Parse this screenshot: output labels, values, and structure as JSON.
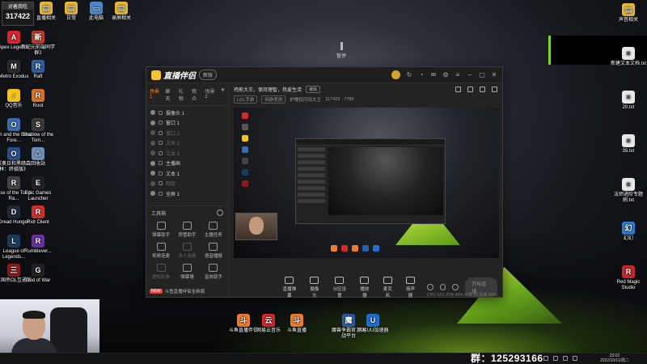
{
  "counter": {
    "title": "对着我吃",
    "value": "317422"
  },
  "desktop_left": [
    {
      "label": "Apex Legends",
      "color": "#d7262e",
      "glyph": "A"
    },
    {
      "label": "Metro Exodus",
      "color": "#2b2b2b",
      "glyph": "M"
    },
    {
      "label": "QQ音乐",
      "color": "#f3c316",
      "glyph": "♪"
    },
    {
      "label": "Ori and the Blind Fore...",
      "color": "#3a6db0",
      "glyph": "O"
    },
    {
      "label": "《奥日和黑暗森林：终极版》",
      "color": "#2b4f8a",
      "glyph": "O"
    },
    {
      "label": "Rise of the Tomb Ra...",
      "color": "#444",
      "glyph": "R"
    },
    {
      "label": "Dread Hunger",
      "color": "#1c2a3c",
      "glyph": "D"
    },
    {
      "label": "League of Legends...",
      "color": "#1c3a5c",
      "glyph": "L"
    },
    {
      "label": "三国杀OL互通版",
      "color": "#8b1a1a",
      "glyph": "三"
    }
  ],
  "desktop_left2": [
    {
      "label": "新纪元前端同学群2",
      "color": "#c23a2a",
      "glyph": "新"
    },
    {
      "label": "Raft",
      "color": "#2d5f9b",
      "glyph": "R"
    },
    {
      "label": "Root",
      "color": "#d8742a",
      "glyph": "R"
    },
    {
      "label": "Shadow of the Tom...",
      "color": "#3a3a3a",
      "glyph": "S"
    },
    {
      "label": "回收站",
      "color": "#6b8fb8",
      "glyph": "♺"
    },
    {
      "label": "Epic Games Launcher",
      "color": "#222",
      "glyph": "E"
    },
    {
      "label": "Riot Client",
      "color": "#d0302b",
      "glyph": "R"
    },
    {
      "label": "Rumblever...",
      "color": "#6b2fa3",
      "glyph": "R"
    },
    {
      "label": "God of War",
      "color": "#222",
      "glyph": "G"
    }
  ],
  "desktop_top": [
    {
      "label": "直播相关",
      "color": "#e4b63a",
      "glyph": "▤"
    },
    {
      "label": "日常",
      "color": "#e4b63a",
      "glyph": "▤"
    },
    {
      "label": "此电脑",
      "color": "#4a87c9",
      "glyph": "▭"
    },
    {
      "label": "录屏相关",
      "color": "#e4b63a",
      "glyph": "▤"
    }
  ],
  "desktop_right": [
    {
      "label": "声音相关",
      "color": "#e4b63a",
      "glyph": "▤"
    },
    {
      "label": "新建文本文档.txt",
      "color": "#e8e8e8",
      "glyph": "≡"
    },
    {
      "label": "20.txt",
      "color": "#e8e8e8",
      "glyph": "≡"
    },
    {
      "label": "35.txt",
      "color": "#e8e8e8",
      "glyph": "≡"
    },
    {
      "label": "法师进阶专题刷.txt",
      "color": "#e8e8e8",
      "glyph": "≡"
    },
    {
      "label": "幻幻",
      "color": "#2a7fd4",
      "glyph": "幻"
    },
    {
      "label": "Red Magic Studio",
      "color": "#c2262e",
      "glyph": "R"
    }
  ],
  "desktop_bottom": [
    {
      "label": "斗鱼直播伴侣",
      "color": "#f07b2b",
      "glyph": "斗"
    },
    {
      "label": "网易云音乐",
      "color": "#d8262e",
      "glyph": "云"
    },
    {
      "label": "斗鱼直播",
      "color": "#f07b2b",
      "glyph": "斗"
    },
    {
      "label": "魔兽争霸官方对战平台",
      "color": "#2b5fa8",
      "glyph": "魔"
    },
    {
      "label": "网易UU加速器",
      "color": "#1d6fd0",
      "glyph": "U"
    }
  ],
  "center_tag": "暂停",
  "window": {
    "app_name": "直播伴侣",
    "badge": "新版",
    "left_tabs": [
      "场景1",
      "聊天",
      "礼物",
      "观众",
      "场景2"
    ],
    "scenes": [
      {
        "label": "摄像头 1",
        "dim": false
      },
      {
        "label": "窗口 1",
        "dim": false
      },
      {
        "label": "窗口 2",
        "dim": true
      },
      {
        "label": "文本 2",
        "dim": true
      },
      {
        "label": "文本 3",
        "dim": true
      },
      {
        "label": "主播画",
        "dim": false
      },
      {
        "label": "文本 1",
        "dim": false
      },
      {
        "label": "图层",
        "dim": true
      },
      {
        "label": "全屏 1",
        "dim": false
      }
    ],
    "tools_title": "工具箱",
    "tools": [
      {
        "label": "弹幕助手",
        "disabled": false
      },
      {
        "label": "房管助手",
        "disabled": false
      },
      {
        "label": "主播任务",
        "disabled": false
      },
      {
        "label": "视频连麦",
        "disabled": false
      },
      {
        "label": "多人连麦",
        "disabled": true
      },
      {
        "label": "语音播报",
        "disabled": false
      },
      {
        "label": "虚拟形象",
        "disabled": true
      },
      {
        "label": "弹幕墙",
        "disabled": false
      },
      {
        "label": "音效助手",
        "disabled": false
      }
    ],
    "left_bottom_flag": "NEW",
    "left_bottom_text": "斗鱼直播伴侣全新版",
    "top_title": "鸡煎大王，保持理智，热爱生活",
    "top_tag": "编辑",
    "info_chip1": "LOL手游",
    "info_chip2": "网游竞技",
    "info_room_name": "护瞳低闪烁大王",
    "info_room_id": "317422",
    "info_count": "7786",
    "bottom_items": [
      "直播弹幕",
      "摄像头",
      "分区设置",
      "播放器",
      "麦克风",
      "扬声器"
    ],
    "start_label": "开始直播",
    "status_text": "CPU 12%  内存 45%  帧率 60  码率 8000"
  },
  "group_label": "群：125293166",
  "clock": {
    "time": "23:02",
    "date": "2022/10/11/周二"
  },
  "colors": {
    "accent": "#ff7b3a",
    "green": "#7dd22b"
  }
}
